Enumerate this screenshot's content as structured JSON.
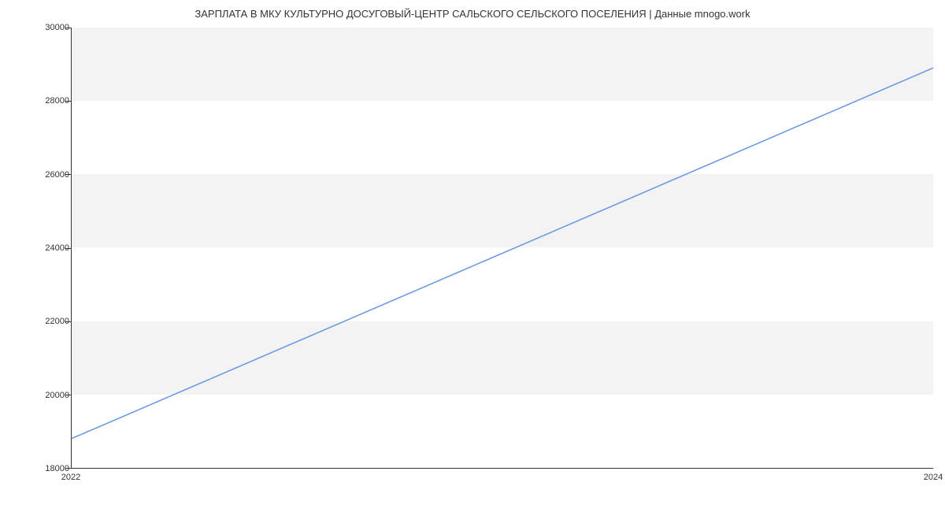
{
  "chart_data": {
    "type": "line",
    "title": "ЗАРПЛАТА В МКУ КУЛЬТУРНО ДОСУГОВЫЙ-ЦЕНТР САЛЬСКОГО СЕЛЬСКОГО ПОСЕЛЕНИЯ | Данные mnogo.work",
    "xlabel": "",
    "ylabel": "",
    "x": [
      2022,
      2024
    ],
    "values": [
      18800,
      28900
    ],
    "xlim": [
      2022,
      2024
    ],
    "ylim": [
      18000,
      30000
    ],
    "y_ticks": [
      18000,
      20000,
      22000,
      24000,
      26000,
      28000,
      30000
    ],
    "x_ticks": [
      2022,
      2024
    ]
  }
}
